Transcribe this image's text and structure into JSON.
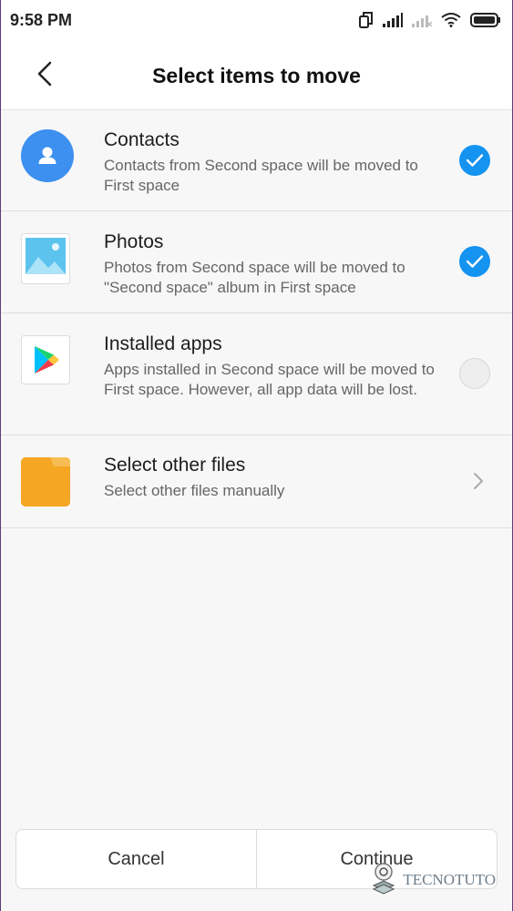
{
  "status_bar": {
    "time": "9:58 PM",
    "icons": [
      "dual-sim-icon",
      "signal-icon",
      "signal-weak-icon",
      "wifi-icon",
      "battery-icon"
    ]
  },
  "header": {
    "title": "Select items to move",
    "back_icon": "back-arrow-icon"
  },
  "items": [
    {
      "title": "Contacts",
      "description": "Contacts from Second space will be moved to First space",
      "icon": "contacts-icon",
      "selected": true
    },
    {
      "title": "Photos",
      "description": "Photos from Second space will be moved to \"Second space\" album in First space",
      "icon": "photos-icon",
      "selected": true
    },
    {
      "title": "Installed apps",
      "description": "Apps installed in Second space will be moved to First space. However, all app data will be lost.",
      "icon": "play-store-icon",
      "selected": false
    },
    {
      "title": "Select other files",
      "description": "Select other files manually",
      "icon": "folder-icon",
      "action": "chevron-right-icon"
    }
  ],
  "footer": {
    "cancel_label": "Cancel",
    "continue_label": "Continue"
  },
  "watermark": {
    "text": "TECNOTUTO"
  },
  "colors": {
    "accent": "#1493f0",
    "folder": "#f5a623",
    "contacts": "#3d8ff0"
  }
}
